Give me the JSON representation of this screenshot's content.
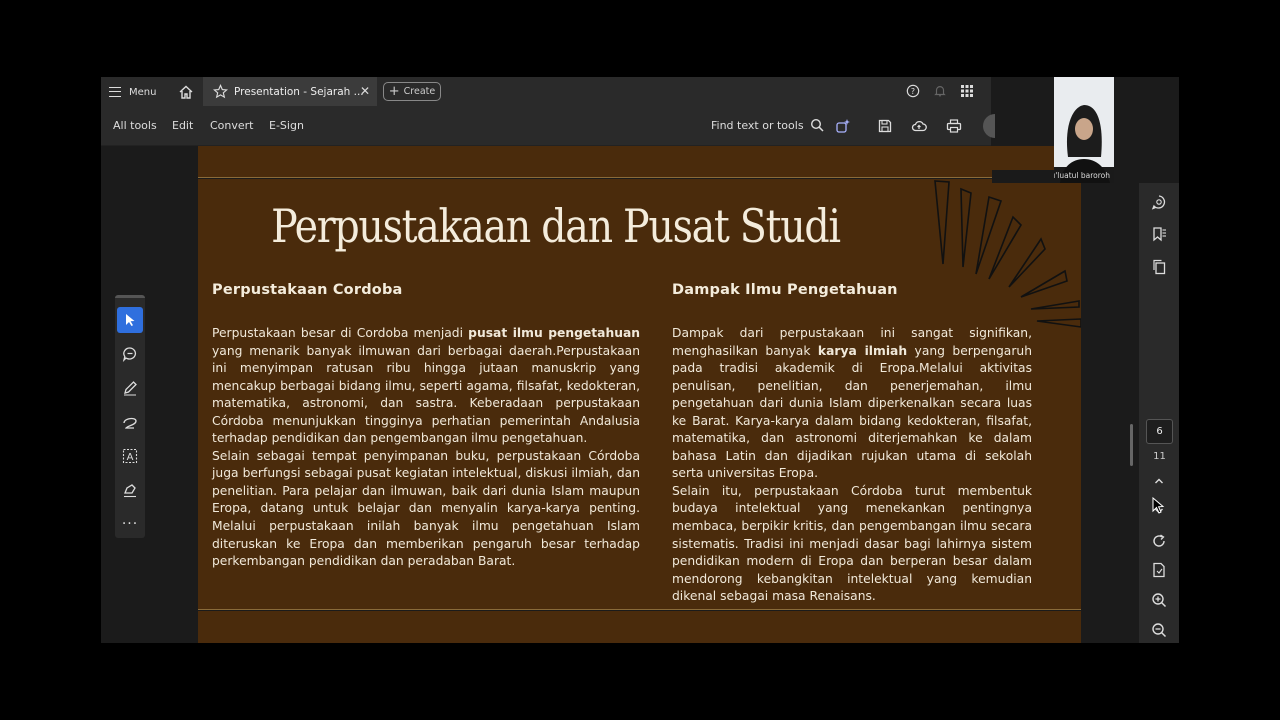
{
  "tabbar": {
    "menu_label": "Menu",
    "doc_tab_title": "Presentation - Sejarah ...",
    "create_label": "Create"
  },
  "toolbar": {
    "items": [
      "All tools",
      "Edit",
      "Convert",
      "E-Sign"
    ],
    "find_label": "Find text or tools"
  },
  "slide": {
    "title": "Perpustakaan dan Pusat Studi",
    "left": {
      "heading": "Perpustakaan Cordoba",
      "p1_before": "Perpustakaan besar di Cordoba menjadi ",
      "p1_bold": "pusat ilmu pengetahuan",
      "p1_after": " yang menarik banyak ilmuwan dari berbagai daerah.Perpustakaan ini menyimpan ratusan ribu hingga jutaan manuskrip yang mencakup berbagai bidang ilmu, seperti agama, filsafat, kedokteran, matematika, astronomi, dan sastra. Keberadaan perpustakaan Córdoba menunjukkan tingginya perhatian pemerintah Andalusia terhadap pendidikan dan pengembangan ilmu pengetahuan.",
      "p2": "Selain sebagai tempat penyimpanan buku, perpustakaan Córdoba juga berfungsi sebagai pusat kegiatan intelektual, diskusi ilmiah, dan penelitian. Para pelajar dan ilmuwan, baik dari dunia Islam maupun Eropa, datang untuk belajar dan menyalin karya-karya penting. Melalui perpustakaan inilah banyak ilmu pengetahuan Islam diteruskan ke Eropa dan memberikan pengaruh besar terhadap perkembangan pendidikan dan peradaban Barat."
    },
    "right": {
      "heading": "Dampak Ilmu Pengetahuan",
      "p1_before": "Dampak dari perpustakaan ini sangat signifikan, menghasilkan banyak ",
      "p1_bold": "karya ilmiah",
      "p1_after": " yang berpengaruh pada tradisi akademik di Eropa.Melalui aktivitas penulisan, penelitian, dan penerjemahan, ilmu pengetahuan dari dunia Islam diperkenalkan secara luas ke Barat. Karya-karya dalam bidang kedokteran, filsafat, matematika, dan astronomi diterjemahkan ke dalam bahasa Latin dan dijadikan rujukan utama di sekolah serta universitas Eropa.",
      "p2": "Selain itu, perpustakaan Córdoba turut membentuk budaya intelektual yang menekankan pentingnya membaca, berpikir kritis, dan pengembangan ilmu secara sistematis. Tradisi ini menjadi dasar bagi lahirnya sistem pendidikan modern di Eropa dan berperan besar dalam mendorong kebangkitan intelektual yang kemudian dikenal sebagai masa Renaisans."
    }
  },
  "pagination": {
    "current": "6",
    "total": "11"
  },
  "webcam": {
    "name": "lu'luatul baroroh"
  },
  "colors": {
    "slide_bg": "#4a2b0c",
    "accent": "#2f6fde",
    "text": "#f4ecdc"
  }
}
